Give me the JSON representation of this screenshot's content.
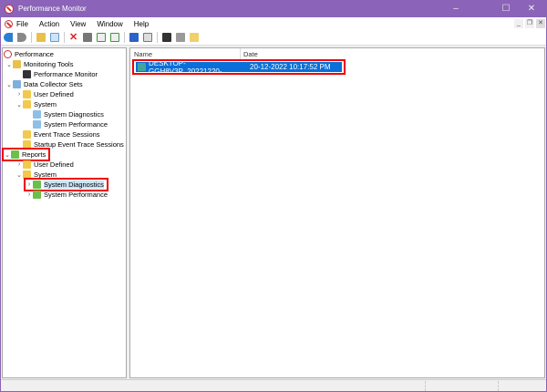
{
  "window": {
    "title": "Performance Monitor",
    "minimize": "–",
    "maximize": "☐",
    "close": "✕"
  },
  "menu": [
    "File",
    "Action",
    "View",
    "Window",
    "Help"
  ],
  "mdi": {
    "minimize": "_",
    "restore": "❐",
    "close": "✕"
  },
  "toolbar": [
    "back-icon",
    "forward-icon",
    "up-folder-icon",
    "show-hide-tree-icon",
    "delete-icon",
    "print-icon",
    "refresh-icon",
    "export-icon",
    "help-icon",
    "properties-icon",
    "monitor-icon",
    "stop-icon",
    "folder-icon"
  ],
  "tree": [
    {
      "label": "Performance",
      "level": 0,
      "chev": "",
      "icon": "performance-icon"
    },
    {
      "label": "Monitoring Tools",
      "level": 1,
      "chev": "⌄",
      "icon": "monitoring-tools-icon"
    },
    {
      "label": "Performance Monitor",
      "level": 2,
      "chev": "",
      "icon": "performance-monitor-icon"
    },
    {
      "label": "Data Collector Sets",
      "level": 1,
      "chev": "⌄",
      "icon": "data-collector-sets-icon"
    },
    {
      "label": "User Defined",
      "level": 2,
      "chev": "›",
      "icon": "folder-icon"
    },
    {
      "label": "System",
      "level": 2,
      "chev": "⌄",
      "icon": "folder-icon"
    },
    {
      "label": "System Diagnostics",
      "level": 3,
      "chev": "",
      "icon": "data-collector-icon"
    },
    {
      "label": "System Performance",
      "level": 3,
      "chev": "",
      "icon": "data-collector-icon"
    },
    {
      "label": "Event Trace Sessions",
      "level": 2,
      "chev": "",
      "icon": "folder-icon"
    },
    {
      "label": "Startup Event Trace Sessions",
      "level": 2,
      "chev": "",
      "icon": "folder-icon"
    },
    {
      "label": "Reports",
      "level": 1,
      "chev": "⌄",
      "icon": "reports-folder-icon",
      "highlight": true
    },
    {
      "label": "User Defined",
      "level": 2,
      "chev": "›",
      "icon": "folder-icon"
    },
    {
      "label": "System",
      "level": 2,
      "chev": "⌄",
      "icon": "folder-icon"
    },
    {
      "label": "System Diagnostics",
      "level": 3,
      "chev": "›",
      "icon": "report-folder-icon",
      "highlight": true
    },
    {
      "label": "System Performance",
      "level": 3,
      "chev": "›",
      "icon": "report-folder-icon"
    }
  ],
  "list": {
    "columns": [
      "Name",
      "Date"
    ],
    "rows": [
      {
        "name": "DESKTOP-GGH8V3P_20221220-...",
        "date": "20-12-2022 10:17:52 PM"
      }
    ]
  },
  "colors": {
    "titlebar": "#8b63b8",
    "selection": "#0a6fd8",
    "highlight": "#e00000"
  }
}
